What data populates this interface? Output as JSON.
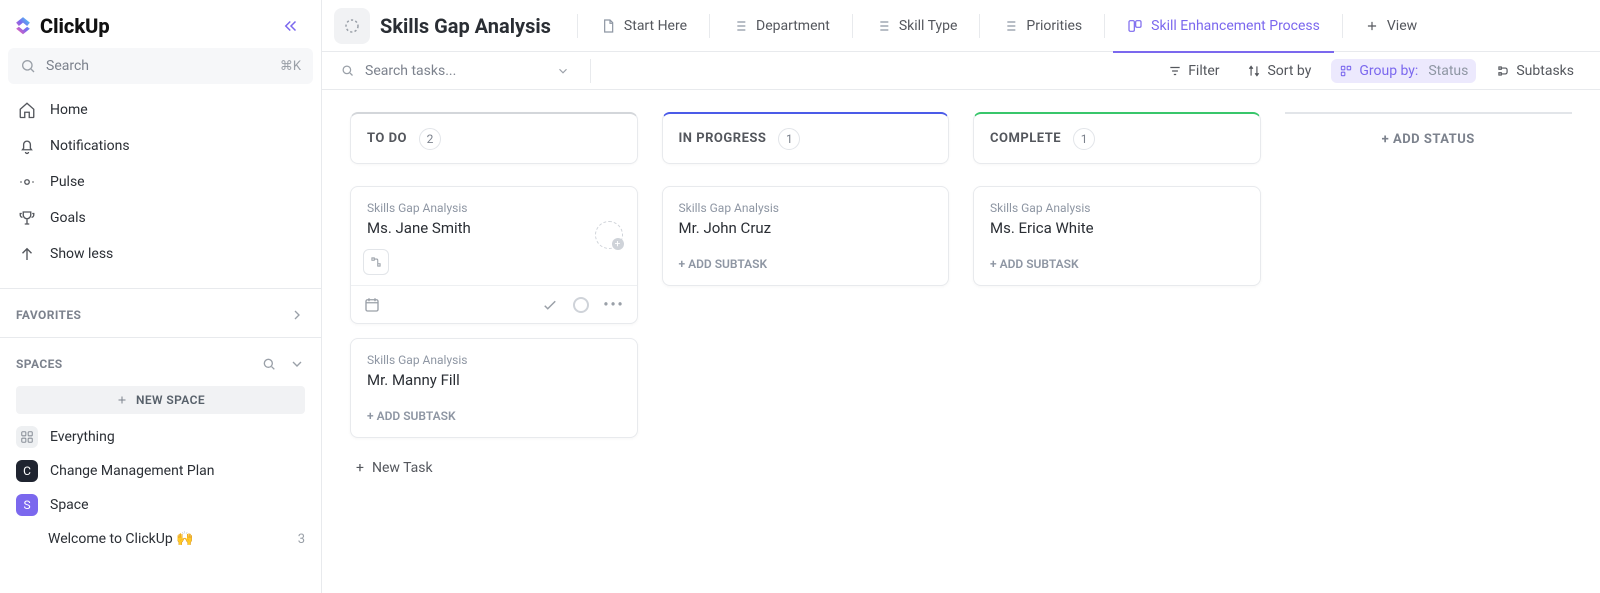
{
  "app": {
    "brand": "ClickUp"
  },
  "sidebar": {
    "search_placeholder": "Search",
    "search_shortcut": "⌘K",
    "nav": [
      {
        "label": "Home"
      },
      {
        "label": "Notifications"
      },
      {
        "label": "Pulse"
      },
      {
        "label": "Goals"
      },
      {
        "label": "Show less"
      }
    ],
    "favorites_label": "FAVORITES",
    "spaces_label": "SPACES",
    "new_space_label": "NEW SPACE",
    "spaces": {
      "everything": "Everything",
      "items": [
        {
          "initial": "C",
          "color": "#1f2430",
          "label": "Change Management Plan"
        },
        {
          "initial": "S",
          "color": "#7b68ee",
          "label": "Space"
        }
      ],
      "sub": {
        "label": "Welcome to ClickUp 🙌",
        "count": "3"
      }
    }
  },
  "header": {
    "list_title": "Skills Gap Analysis",
    "views": [
      {
        "label": "Start Here",
        "icon": "doc"
      },
      {
        "label": "Department",
        "icon": "list"
      },
      {
        "label": "Skill Type",
        "icon": "list"
      },
      {
        "label": "Priorities",
        "icon": "list"
      },
      {
        "label": "Skill Enhancement Process",
        "icon": "board",
        "active": true
      }
    ],
    "add_view": "View"
  },
  "toolbar": {
    "search_placeholder": "Search tasks...",
    "filter": "Filter",
    "sort": "Sort by",
    "group_prefix": "Group by:",
    "group_value": "Status",
    "subtasks": "Subtasks"
  },
  "board": {
    "columns": [
      {
        "key": "todo",
        "title": "TO DO",
        "count": "2",
        "cards": [
          {
            "crumb": "Skills Gap Analysis",
            "name": "Ms. Jane Smith",
            "hovered": true
          },
          {
            "crumb": "Skills Gap Analysis",
            "name": "Mr. Manny Fill"
          }
        ],
        "new_task": "New Task"
      },
      {
        "key": "progress",
        "title": "IN PROGRESS",
        "count": "1",
        "cards": [
          {
            "crumb": "Skills Gap Analysis",
            "name": "Mr. John Cruz"
          }
        ]
      },
      {
        "key": "complete",
        "title": "COMPLETE",
        "count": "1",
        "cards": [
          {
            "crumb": "Skills Gap Analysis",
            "name": "Ms. Erica White"
          }
        ]
      }
    ],
    "add_subtask_label": "+ ADD SUBTASK",
    "add_status_label": "+ ADD STATUS"
  }
}
